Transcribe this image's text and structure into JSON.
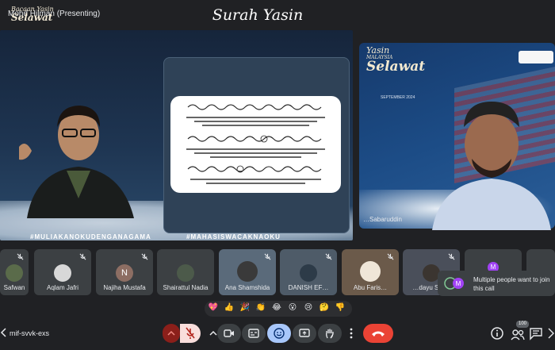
{
  "presenter_bar": {
    "label": "Mohd Hilman (Presenting)"
  },
  "slide": {
    "logo_line1": "Bacaan Yasin",
    "logo_line2": "Selawat",
    "logo_line3": "",
    "title": "Surah Yasin",
    "hashtag_1": "#MULIAKANOKUDENGANAGAMA",
    "hashtag_2": "#MAHASISWACAKNAOKU"
  },
  "big_tile": {
    "logo_line1": "Yasin",
    "logo_line2": "MALAYSIA",
    "logo_line3": "Selawat",
    "date": "SEPTEMBER 2024",
    "name": "…Sabaruddin"
  },
  "participants": [
    {
      "name": "Safwan",
      "avatar": ""
    },
    {
      "name": "Aqlam Jafri",
      "avatar": ""
    },
    {
      "name": "Najiha Mustafa",
      "avatar": "N",
      "avatar_color": "#8d6e63"
    },
    {
      "name": "Shairattul Nadia",
      "avatar": ""
    },
    {
      "name": "Ana Shamshida",
      "avatar": ""
    },
    {
      "name": "DANISH EF…",
      "avatar": ""
    },
    {
      "name": "Abu Faris…",
      "avatar": ""
    },
    {
      "name": "…dayu Sol…",
      "avatar": ""
    },
    {
      "name": "",
      "avatar": "M",
      "avatar_color": "#a142f4"
    }
  ],
  "notification": {
    "text": "Multiple people want to join this call"
  },
  "reactions": [
    "💖",
    "👍",
    "🎉",
    "👏",
    "😂",
    "😮",
    "😢",
    "🤔",
    "👎"
  ],
  "toolbar": {
    "meeting_code": "mif-svvk-exs",
    "participant_count": "100"
  },
  "colors": {
    "background": "#202124",
    "tile": "#3c4043",
    "leave": "#ea4335",
    "accent_blue": "#8ab4f8"
  }
}
